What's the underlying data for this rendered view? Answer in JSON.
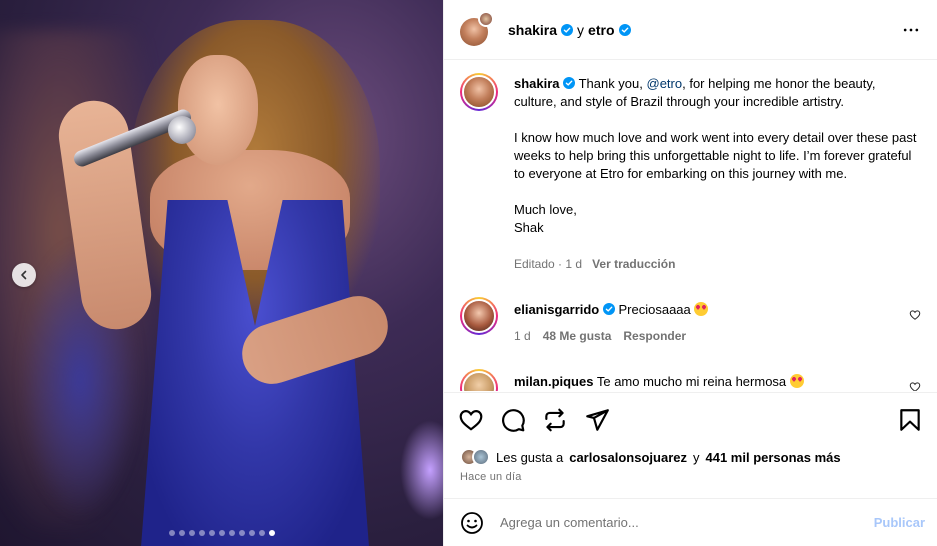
{
  "post": {
    "author": "shakira",
    "separator": "y",
    "collaborator": "etro"
  },
  "caption": {
    "username": "shakira",
    "line1_pre": "Thank you, ",
    "mention": "@etro",
    "line1_post": ", for helping me honor the beauty, culture, and style of Brazil through your incredible artistry.",
    "para2": "I know how much love and work went into every detail over these past weeks to help bring this unforgettable night to life. I’m forever grateful to everyone at Etro for embarking on this journey with me.",
    "signoff1": "Much love,",
    "signoff2": "Shak",
    "edited": "Editado",
    "time": "1 d",
    "translate": "Ver traducción"
  },
  "comments": [
    {
      "username": "elianisgarrido",
      "text": "Preciosaaaa",
      "time": "1 d",
      "likes": "48 Me gusta",
      "reply": "Responder"
    },
    {
      "username": "milan.piques",
      "text": "Te amo mucho mi reina hermosa",
      "time": "",
      "likes": "",
      "reply": ""
    }
  ],
  "likes": {
    "prefix": "Les gusta a",
    "user": "carlosalonsojuarez",
    "conj": "y",
    "others": "441 mil personas más"
  },
  "timestamp": "Hace un día",
  "composer": {
    "placeholder": "Agrega un comentario...",
    "publish": "Publicar"
  },
  "carousel": {
    "total": 11,
    "active_index": 10
  },
  "colors": {
    "verified": "#0095f6",
    "link": "#00376b",
    "muted": "#737373",
    "publish": "#a8c7fa"
  }
}
